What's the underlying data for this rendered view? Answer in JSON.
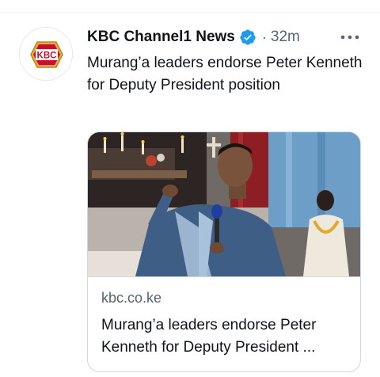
{
  "tweet": {
    "author": {
      "name": "KBC Channel1 News",
      "verified": true,
      "avatar_icon": "kbc-logo",
      "avatar_text": "KBC"
    },
    "separator": "·",
    "timestamp": "32m",
    "more_icon": "more-dots-icon",
    "text": "Murang’a leaders endorse Peter Kenneth for Deputy President position",
    "card": {
      "domain": "kbc.co.ke",
      "title": "Murang’a leaders endorse Peter Kenneth for Deputy President ..."
    }
  },
  "colors": {
    "text_primary": "#0f1419",
    "text_secondary": "#536471",
    "verified_blue": "#1d9bf0",
    "border": "#cfd9de"
  }
}
